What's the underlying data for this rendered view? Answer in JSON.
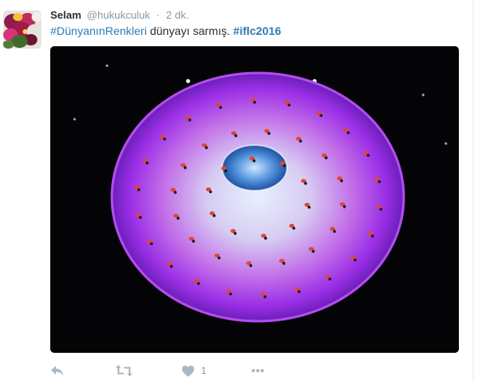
{
  "tweet": {
    "display_name": "Selam",
    "handle": "@hukukculuk",
    "separator": "·",
    "timestamp": "2 dk.",
    "text": {
      "hashtag1": "#DünyanınRenkleri",
      "middle": " dünyayı sarmış. ",
      "hashtag2": "#iflc2016"
    },
    "avatar_icon": "flower-bouquet-avatar",
    "media_description_icon": "stage-performance-photo",
    "actions": {
      "reply_icon": "reply-icon",
      "retweet_icon": "retweet-icon",
      "like_icon": "heart-icon",
      "like_count": "1",
      "more_icon": "more-icon"
    }
  },
  "colors": {
    "link": "#2b7bb9",
    "name": "#292f33",
    "muted": "#8899a6",
    "action_icon": "#aab8c2",
    "stage_purple": "#8a2be2",
    "stage_center": "#e8f0ff"
  }
}
